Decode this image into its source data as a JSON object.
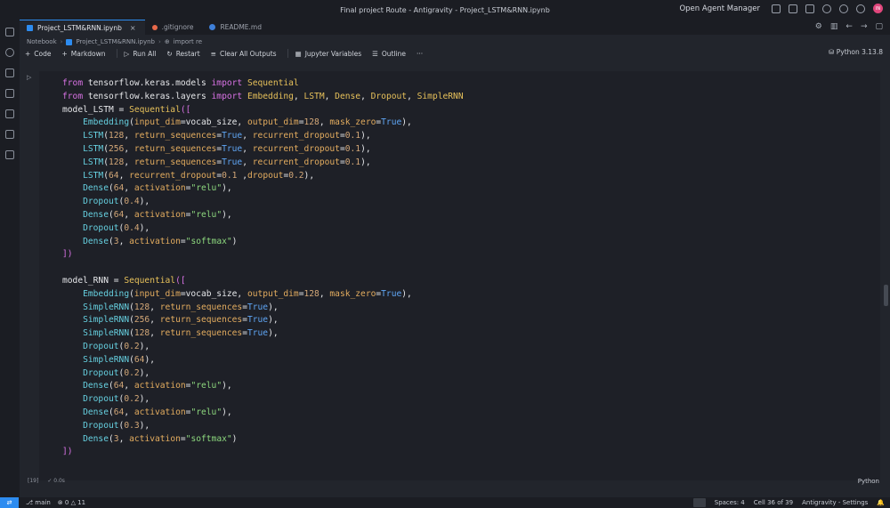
{
  "window": {
    "title": "Final project Route - Antigravity - Project_LSTM&RNN.ipynb",
    "agent_manager": "Open Agent Manager",
    "avatar_initials": "IN"
  },
  "tabs": [
    {
      "label": "Project_LSTM&RNN.ipynb",
      "active": true
    },
    {
      "label": ".gitignore"
    },
    {
      "label": "README.md"
    }
  ],
  "breadcrumb": [
    "Notebook",
    "Project_LSTM&RNN.ipynb",
    "import re"
  ],
  "toolbar": {
    "code": "Code",
    "markdown": "Markdown",
    "run_all": "Run All",
    "restart": "Restart",
    "clear": "Clear All Outputs",
    "variables": "Jupyter Variables",
    "outline": "Outline",
    "more": "···",
    "kernel": "Python 3.13.8"
  },
  "cell": {
    "exec_count": "[19]",
    "time": "0.0s",
    "language": "Python"
  },
  "status": {
    "branch": "main",
    "problems": "0 △ 11",
    "spaces": "Spaces: 4",
    "cell_pos": "Cell 36 of 39",
    "settings": "Antigravity - Settings"
  },
  "colors": {
    "accent": "#2d8cf0",
    "keyword": "#d872e4",
    "function": "#66d0e0",
    "class": "#e6c05a",
    "string": "#8dd87e",
    "boolean": "#5fa5f4"
  }
}
